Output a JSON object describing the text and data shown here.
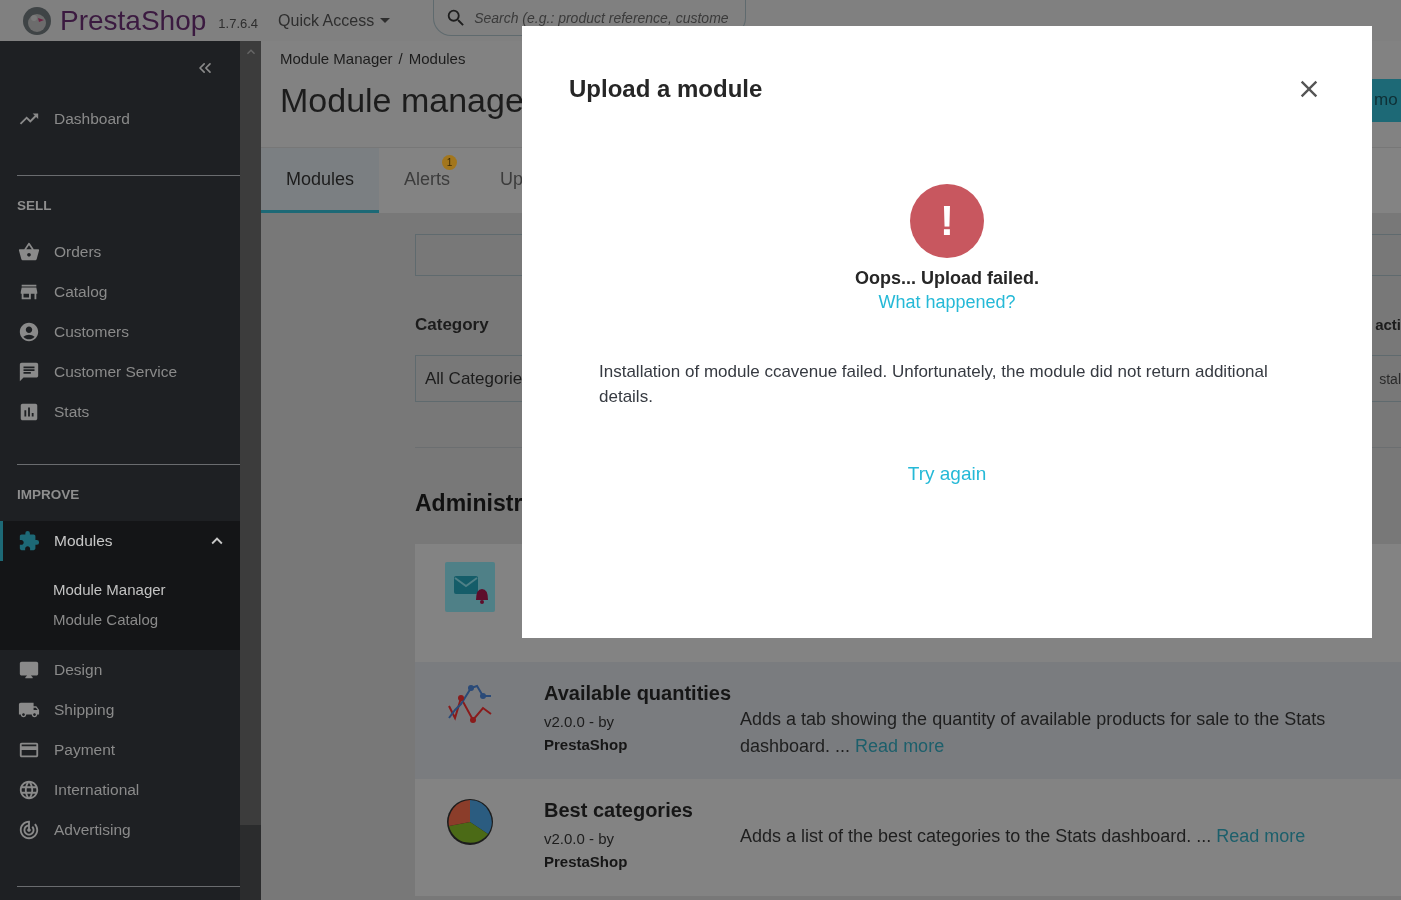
{
  "header": {
    "brand": "PrestaShop",
    "version": "1.7.6.4",
    "quick_access": "Quick Access",
    "search": {
      "placeholder": "Search (e.g.: product reference, custome"
    }
  },
  "sidebar": {
    "top": [
      {
        "label": "Dashboard",
        "selected": false
      }
    ],
    "sections": [
      {
        "heading": "SELL",
        "items": [
          {
            "label": "Orders",
            "selected": false,
            "expanded": false
          },
          {
            "label": "Catalog",
            "selected": false,
            "expanded": false
          },
          {
            "label": "Customers",
            "selected": false,
            "expanded": false
          },
          {
            "label": "Customer Service",
            "selected": false,
            "expanded": false
          },
          {
            "label": "Stats",
            "selected": false,
            "expanded": false
          }
        ]
      },
      {
        "heading": "IMPROVE",
        "items": [
          {
            "label": "Modules",
            "selected": true,
            "expanded": true,
            "children": [
              {
                "label": "Module Manager",
                "selected": true
              },
              {
                "label": "Module Catalog",
                "selected": false
              }
            ]
          },
          {
            "label": "Design",
            "selected": false,
            "expanded": false
          },
          {
            "label": "Shipping",
            "selected": false,
            "expanded": false
          },
          {
            "label": "Payment",
            "selected": false,
            "expanded": false
          },
          {
            "label": "International",
            "selected": false,
            "expanded": false
          },
          {
            "label": "Advertising",
            "selected": false,
            "expanded": false
          }
        ]
      }
    ]
  },
  "breadcrumb": {
    "items": [
      "Module Manager",
      "Modules"
    ],
    "separators": [
      "/"
    ]
  },
  "page_title": "Module manage",
  "toolbar_button": "mo",
  "tabs": [
    {
      "label": "Modules",
      "selected": true
    },
    {
      "label": "Alerts",
      "selected": false,
      "badge": "1"
    },
    {
      "label": "Up",
      "selected": false
    }
  ],
  "filters": {
    "category_label": "Category",
    "category_value": "All Categorie",
    "column_3_label": "acti",
    "column_3_value": "stal"
  },
  "section_title": "Administr",
  "modules": [
    {
      "kind": "covered"
    },
    {
      "kind": "full",
      "name": "Available quantities",
      "version": "v2.0.0 - by",
      "author": "PrestaShop",
      "description": "Adds a tab showing the quantity of available products for sale to the Stats dashboard. ...",
      "read_more": "Read more"
    },
    {
      "kind": "full",
      "name": "Best categories",
      "version": "v2.0.0 - by",
      "author": "PrestaShop",
      "description": "Adds a list of the best categories to the Stats dashboard. ...",
      "read_more": "Read more"
    }
  ],
  "modal": {
    "title": "Upload a module",
    "alert_glyph": "!",
    "heading": "Oops... Upload failed.",
    "help_link": "What happened?",
    "message": "Installation of module ccavenue failed. Unfortunately, the module did not return additional details.",
    "retry": "Try again"
  }
}
